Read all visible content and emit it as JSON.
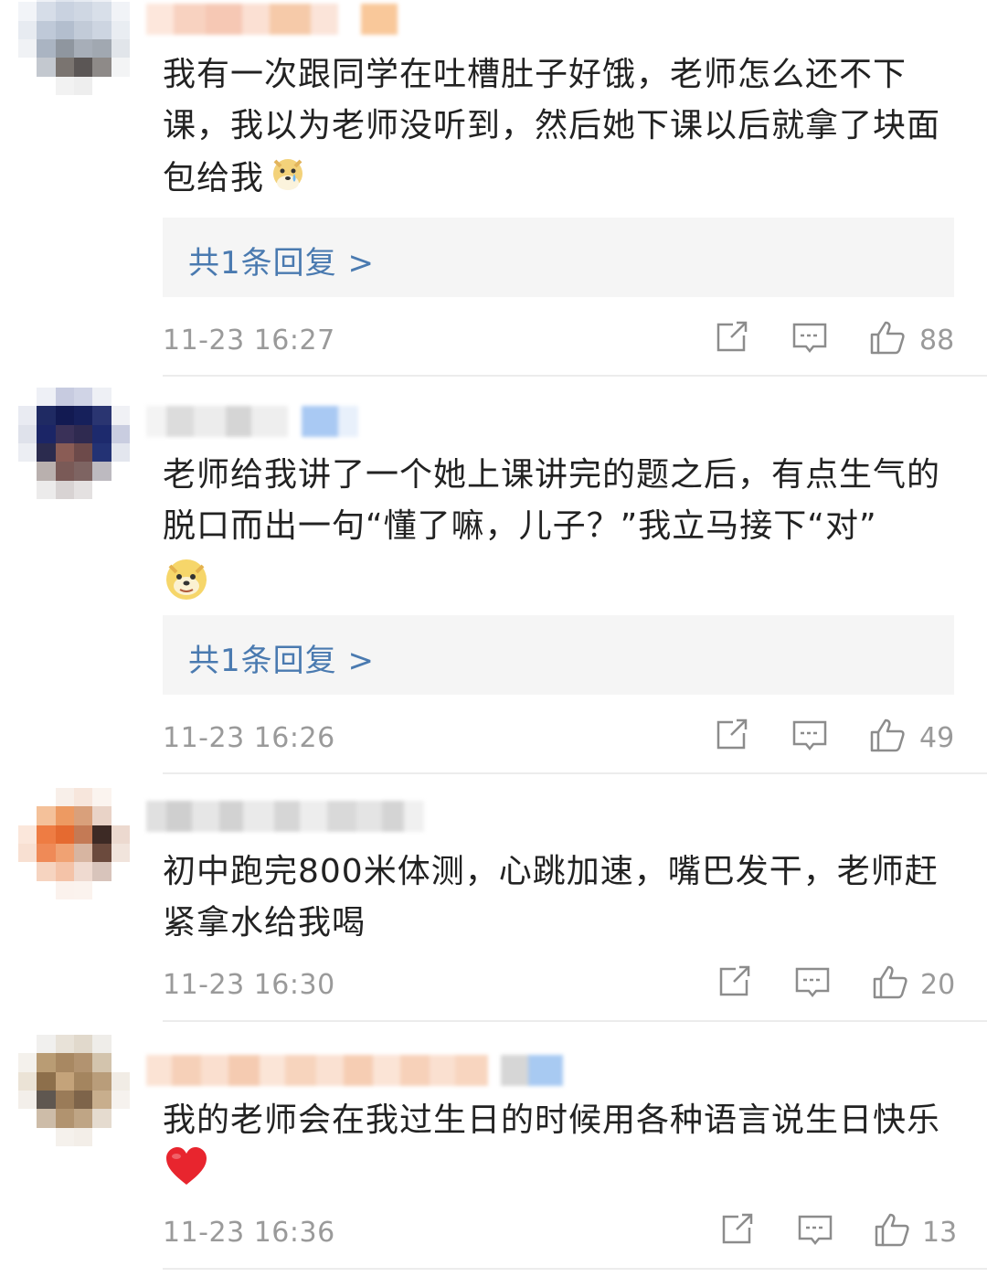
{
  "comments": [
    {
      "text": "我有一次跟同学在吐槽肚子好饿，老师怎么还不下课，我以为老师没听到，然后她下课以后就拿了块面包给我",
      "emoji": "crying-doge-emoji",
      "replies_label": "共1条回复 >",
      "time": "11-23 16:27",
      "likes": "88"
    },
    {
      "text": "老师给我讲了一个她上课讲完的题之后，有点生气的脱口而出一句“懂了嘛，儿子？”我立马接下“对”",
      "emoji": "doge-emoji",
      "replies_label": "共1条回复 >",
      "time": "11-23 16:26",
      "likes": "49"
    },
    {
      "text": "初中跑完800米体测，心跳加速，嘴巴发干，老师赶紧拿水给我喝",
      "time": "11-23 16:30",
      "likes": "20"
    },
    {
      "text": "我的老师会在我过生日的时候用各种语言说生日快乐",
      "emoji": "red-heart-emoji",
      "time": "11-23 16:36",
      "likes": "13"
    }
  ],
  "icons": [
    "share-icon",
    "comment-icon",
    "like-icon"
  ],
  "colors": {
    "link": "#4a7ab0",
    "meta": "#9a9a9a",
    "text": "#222222",
    "reply_bg": "#f5f5f5"
  }
}
